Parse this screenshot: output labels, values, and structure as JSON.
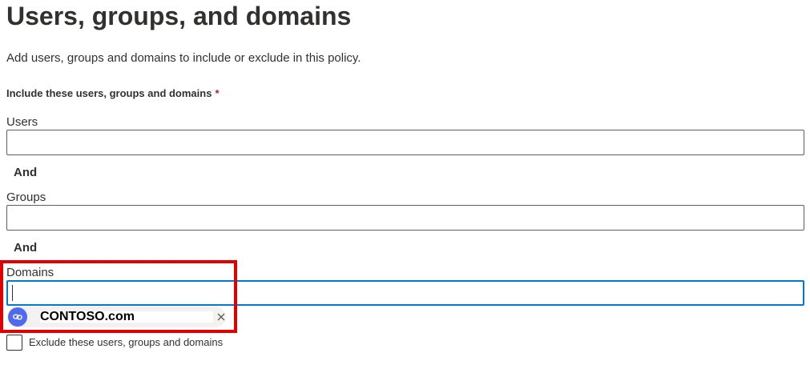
{
  "page": {
    "title": "Users, groups, and domains",
    "description": "Add users, groups and domains to include or exclude in this policy."
  },
  "include_section": {
    "label": "Include these users, groups and domains",
    "required_marker": "*"
  },
  "fields": {
    "users": {
      "label": "Users",
      "value": ""
    },
    "groups": {
      "label": "Groups",
      "value": ""
    },
    "domains": {
      "label": "Domains",
      "value": "",
      "focused": true
    }
  },
  "connectors": {
    "and_1": "And",
    "and_2": "And"
  },
  "domain_chips": [
    {
      "text": "CONTOSO.com",
      "icon": "link-icon",
      "remove_icon": "close-icon"
    }
  ],
  "exclude": {
    "label": "Exclude these users, groups and domains",
    "checked": false
  },
  "colors": {
    "text": "#323130",
    "focus_border": "#0078d4",
    "required": "#a4262c",
    "highlight": "#e00000",
    "chip_avatar": "#4f6bed",
    "chip_bg": "#f3f2f1"
  }
}
